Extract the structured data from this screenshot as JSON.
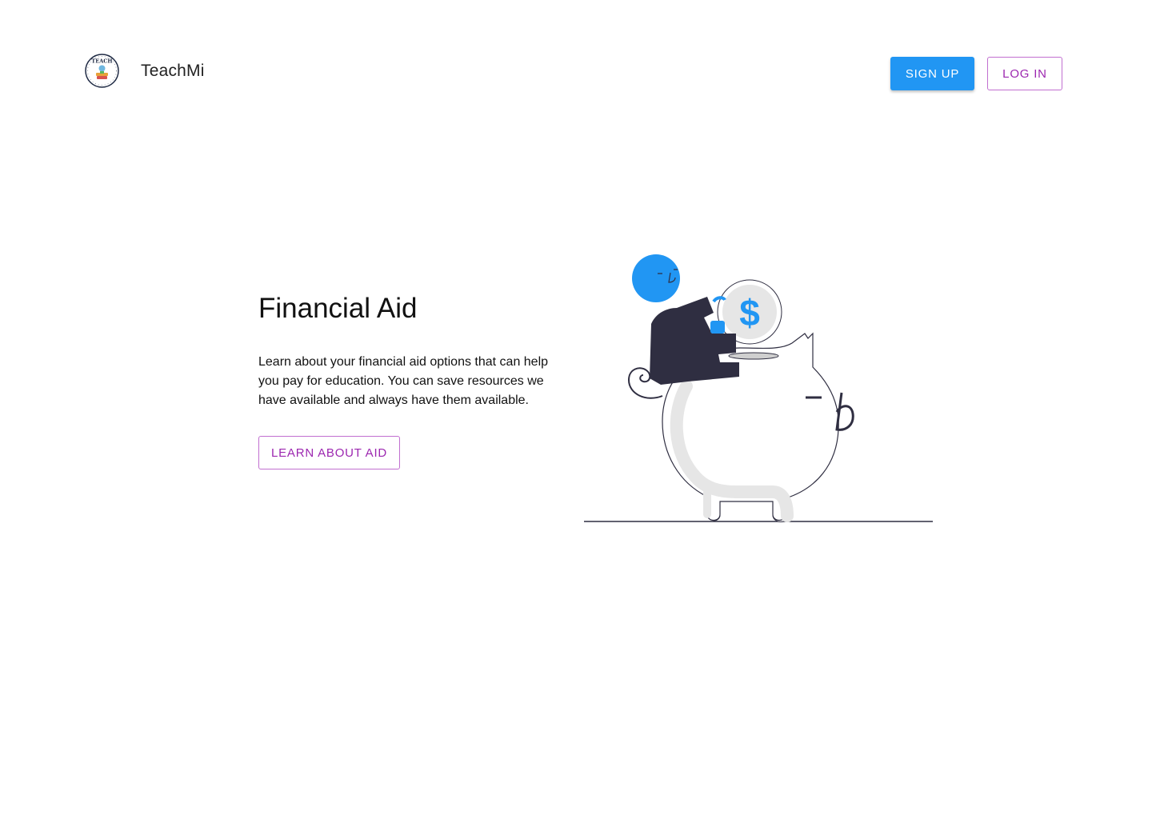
{
  "header": {
    "logo_text": "TEACH",
    "brand": "TeachMi",
    "signup_label": "SIGN UP",
    "login_label": "LOG IN"
  },
  "hero": {
    "title": "Financial Aid",
    "description": "Learn about your financial aid options that can help you pay for education. You can save resources we have available and always have them available.",
    "cta_label": "LEARN ABOUT AID",
    "coin_symbol": "$"
  },
  "colors": {
    "primary_blue": "#2196f3",
    "accent_purple": "#9c27b0",
    "dark_navy": "#2f2e41",
    "light_gray": "#e6e6e6"
  },
  "icons": {
    "logo": "teachmi-logo-icon",
    "illustration": "piggy-bank-illustration"
  }
}
